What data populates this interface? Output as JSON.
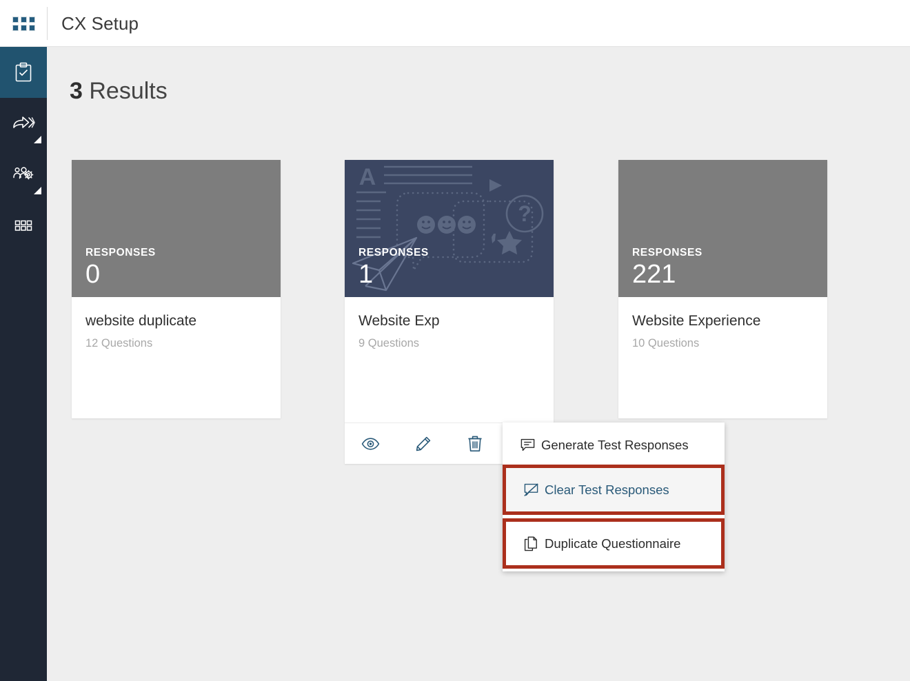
{
  "header": {
    "title": "CX Setup",
    "waffle_icon": "apps-grid-icon"
  },
  "sidebar": {
    "items": [
      {
        "icon": "clipboard-check-icon",
        "name": "questionnaires",
        "active": true,
        "has_submenu": false
      },
      {
        "icon": "share-arrow-icon",
        "name": "distribution",
        "active": false,
        "has_submenu": true
      },
      {
        "icon": "user-settings-icon",
        "name": "administration",
        "active": false,
        "has_submenu": true
      },
      {
        "icon": "modules-grid-icon",
        "name": "modules",
        "active": false,
        "has_submenu": false
      }
    ]
  },
  "main": {
    "results_count": "3",
    "results_label": "Results",
    "cards": [
      {
        "responses_label": "RESPONSES",
        "responses_value": "0",
        "title": "website duplicate",
        "questions": "12 Questions",
        "banner_style": "plain",
        "has_actions": false
      },
      {
        "responses_label": "RESPONSES",
        "responses_value": "1",
        "title": "Website Exp",
        "questions": "9 Questions",
        "banner_style": "illustrated",
        "has_actions": true,
        "actions": [
          {
            "icon": "eye-icon",
            "name": "preview-button"
          },
          {
            "icon": "pencil-icon",
            "name": "edit-button"
          },
          {
            "icon": "trash-icon",
            "name": "delete-button"
          },
          {
            "icon": "kebab-menu-icon",
            "name": "more-options-button"
          }
        ]
      },
      {
        "responses_label": "RESPONSES",
        "responses_value": "221",
        "title": "Website Experience",
        "questions": "10 Questions",
        "banner_style": "plain",
        "has_actions": false
      }
    ]
  },
  "context_menu": {
    "items": [
      {
        "label": "Generate Test Responses",
        "icon": "comment-lines-icon",
        "state": "normal"
      },
      {
        "label": "Clear Test Responses",
        "icon": "comment-slash-icon",
        "state": "highlighted"
      },
      {
        "label": "Duplicate Questionnaire",
        "icon": "copy-pages-icon",
        "state": "outlined"
      }
    ]
  },
  "colors": {
    "nav_background": "#1f2735",
    "nav_active": "#21536f",
    "accent_blue": "#2a5a79",
    "highlight_red": "#ab2f1c",
    "banner_gray": "#7d7d7d",
    "banner_navy": "#3b4662",
    "page_background": "#eeeeee"
  }
}
